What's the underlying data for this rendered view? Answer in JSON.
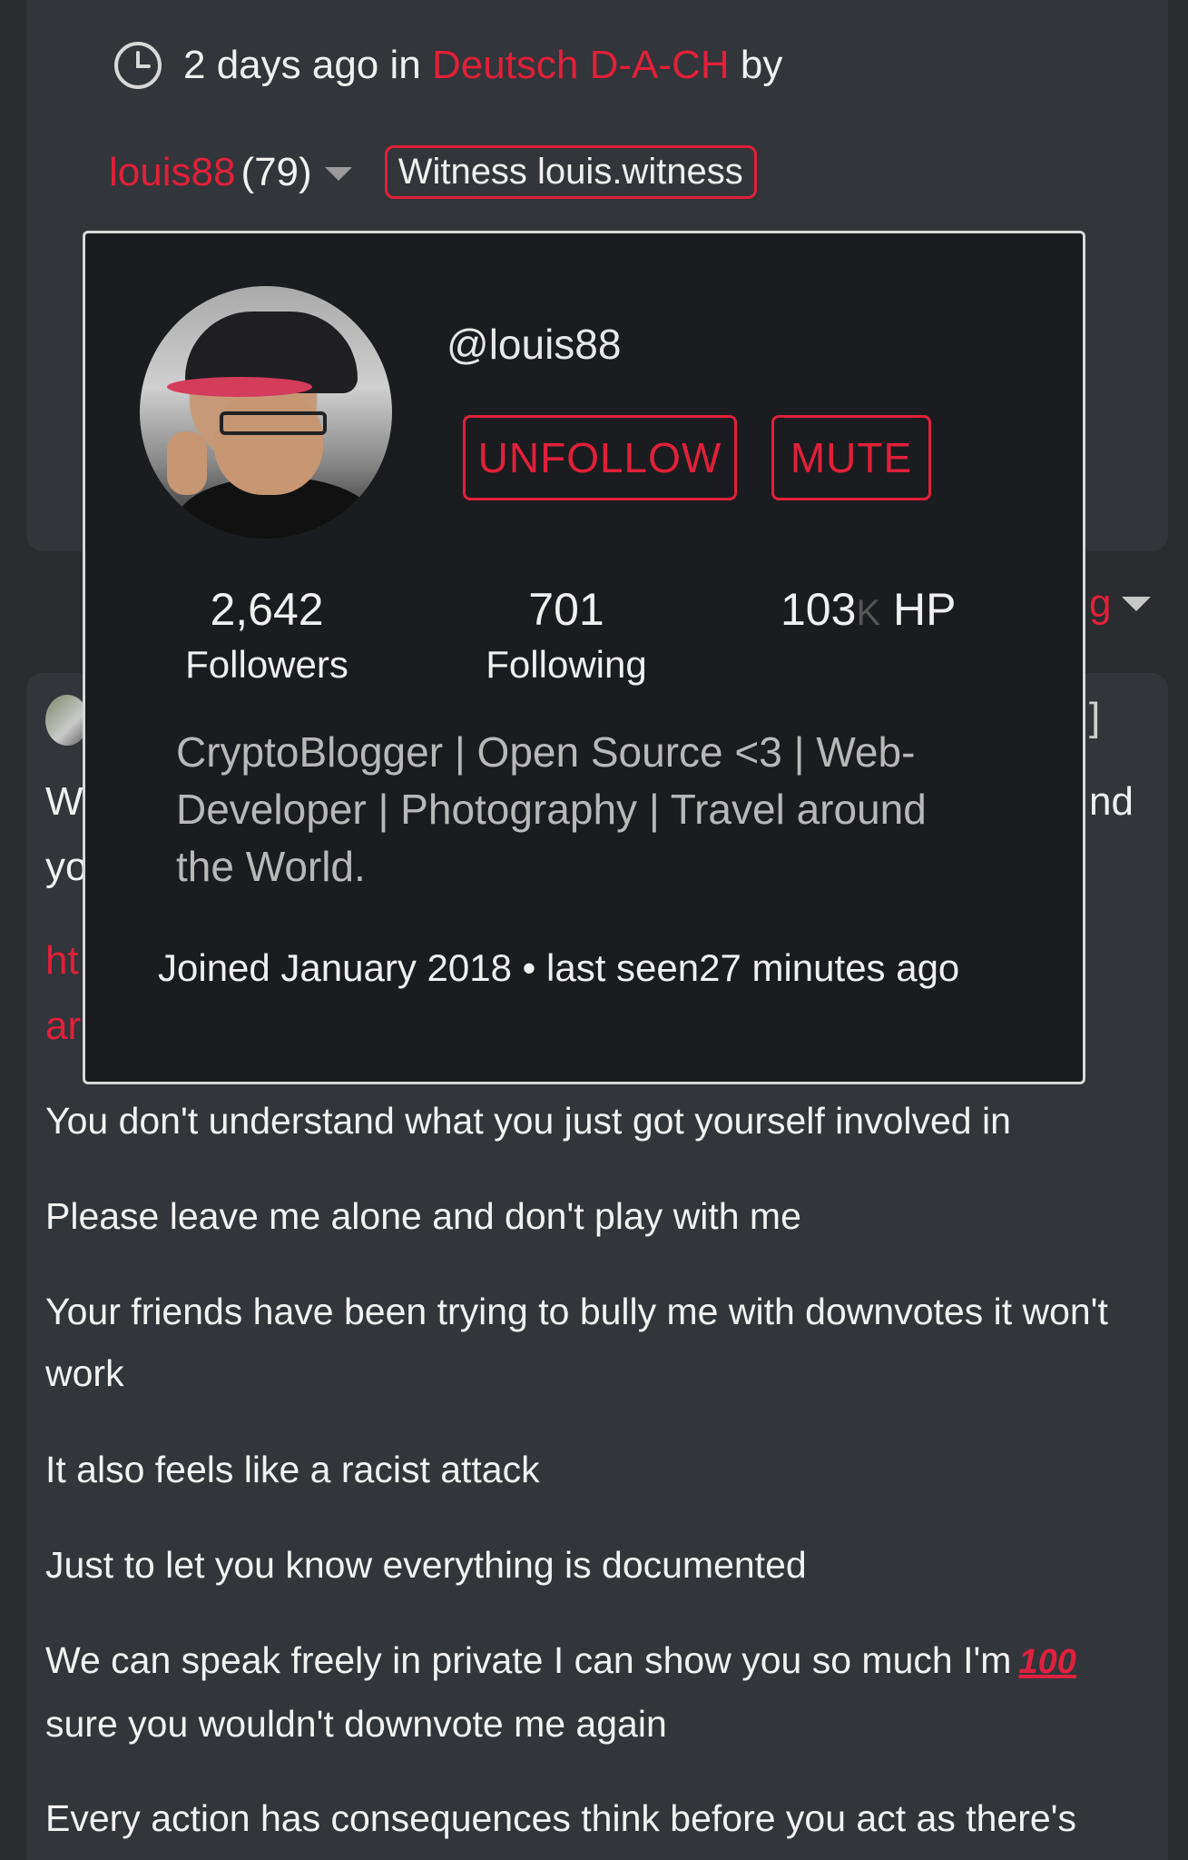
{
  "post_meta": {
    "time": "2 days ago in",
    "community": "Deutsch D-A-CH",
    "by": "by"
  },
  "author": {
    "name": "louis88",
    "reputation": "(79)",
    "witness_badge": "Witness louis.witness"
  },
  "profile_popup": {
    "handle": "@louis88",
    "unfollow_label": "UNFOLLOW",
    "mute_label": "MUTE",
    "followers_count": "2,642",
    "followers_label": "Followers",
    "following_count": "701",
    "following_label": "Following",
    "hp_value": "103",
    "hp_k": "K",
    "hp_label": "HP",
    "bio": "CryptoBlogger | Open Source <3 | Web-Developer | Photography | Travel around the World.",
    "joined": "Joined January 2018 • last seen27 minutes ago"
  },
  "background_fragments": {
    "side_g": "g",
    "side_bracket": "]",
    "side_nd": "nd",
    "frag_w": "W",
    "frag_yo": "yo",
    "frag_ht": "ht",
    "frag_ar": "ar"
  },
  "comment": {
    "lines": [
      "You don't understand what you just got yourself involved in",
      "Please leave me alone and don't play with me",
      "Your friends have been trying to bully me with downvotes it won't work",
      "It also feels like a racist attack",
      "Just to let you know everything is documented",
      "We can speak freely in private I can show you so much I'm",
      "sure you wouldn't downvote me again",
      "Every action has consequences think before you act as there's"
    ],
    "emoji_100": "100"
  },
  "colors": {
    "accent": "#e0203b",
    "background": "#2a2c2f",
    "card": "#32353a",
    "popup": "#1b1c1f"
  }
}
